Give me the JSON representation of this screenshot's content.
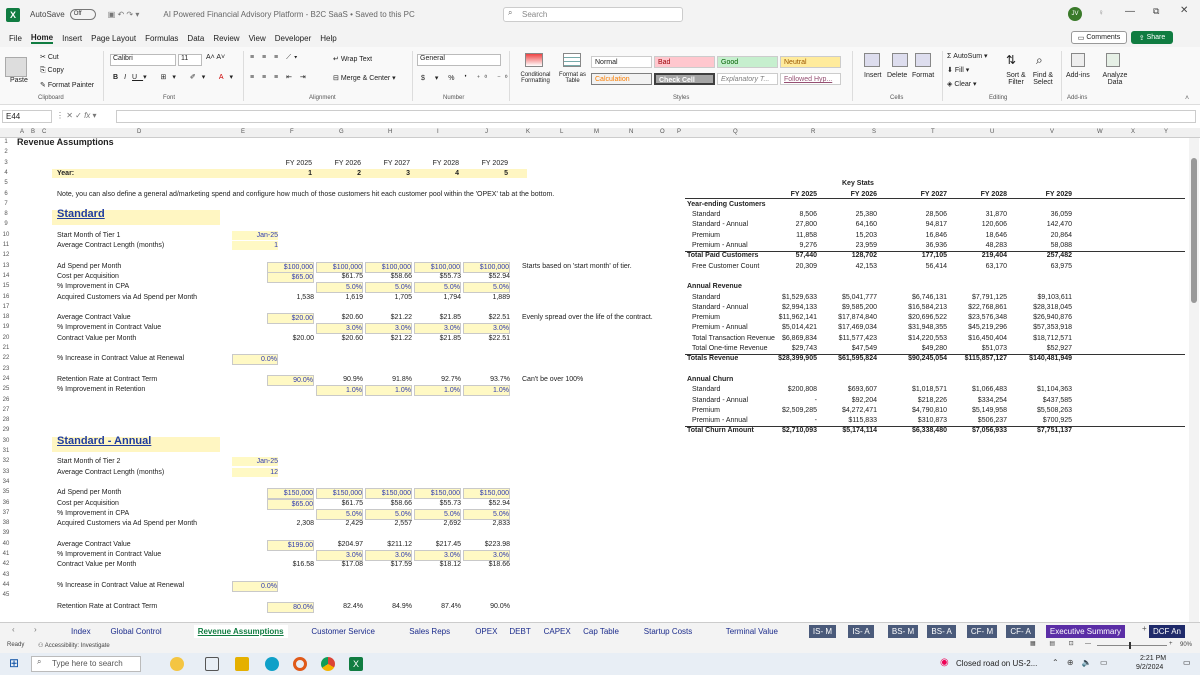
{
  "titlebar": {
    "autosave_label": "AutoSave",
    "autosave_state": "Off",
    "title": "AI Powered Financial Advisory Platform - B2C SaaS • Saved to this PC",
    "search_placeholder": "Search",
    "avatar": "JV"
  },
  "menu": {
    "items": [
      "File",
      "Home",
      "Insert",
      "Page Layout",
      "Formulas",
      "Data",
      "Review",
      "View",
      "Developer",
      "Help"
    ],
    "active": "Home",
    "comments": "Comments",
    "share": "Share"
  },
  "ribbon": {
    "clipboard": {
      "paste": "Paste",
      "cut": "Cut",
      "copy": "Copy",
      "painter": "Format Painter",
      "label": "Clipboard"
    },
    "font": {
      "name": "Calibri",
      "size": "11",
      "label": "Font"
    },
    "alignment": {
      "wrap": "Wrap Text",
      "merge": "Merge & Center",
      "label": "Alignment"
    },
    "number": {
      "format": "General",
      "label": "Number"
    },
    "styles": {
      "cond": "Conditional Formatting",
      "table": "Format as Table",
      "normal": "Normal",
      "bad": "Bad",
      "good": "Good",
      "neutral": "Neutral",
      "calc": "Calculation",
      "check": "Check Cell",
      "expl": "Explanatory T...",
      "followed": "Followed Hyp...",
      "label": "Styles"
    },
    "cells": {
      "insert": "Insert",
      "delete": "Delete",
      "format": "Format",
      "label": "Cells"
    },
    "editing": {
      "autosum": "AutoSum",
      "fill": "Fill",
      "clear": "Clear",
      "sort": "Sort & Filter",
      "find": "Find & Select",
      "label": "Editing"
    },
    "addins": {
      "addins": "Add-ins",
      "analyze": "Analyze Data",
      "label": "Add-ins"
    }
  },
  "formula_bar": {
    "cell": "E44",
    "value": ""
  },
  "columns": [
    "A",
    "B",
    "C",
    "D",
    "E",
    "F",
    "G",
    "H",
    "I",
    "J",
    "K",
    "L",
    "M",
    "N",
    "O",
    "P",
    "Q",
    "R",
    "S",
    "T",
    "U",
    "V",
    "W",
    "X",
    "Y"
  ],
  "rows": [
    "1",
    "2",
    "3",
    "4",
    "5",
    "6",
    "7",
    "8",
    "9",
    "10",
    "11",
    "12",
    "13",
    "14",
    "15",
    "16",
    "17",
    "18",
    "19",
    "20",
    "21",
    "22",
    "23",
    "24",
    "25",
    "26",
    "27",
    "28",
    "29",
    "30",
    "31",
    "32",
    "33",
    "34",
    "35",
    "36",
    "37",
    "38",
    "39",
    "40",
    "41",
    "42",
    "43",
    "44",
    "45"
  ],
  "sheet": {
    "title": "Revenue Assumptions",
    "years": [
      "FY 2025",
      "FY 2026",
      "FY 2027",
      "FY 2028",
      "FY 2029"
    ],
    "year_label": "Year:",
    "year_nums": [
      "1",
      "2",
      "3",
      "4",
      "5"
    ],
    "note": "Note, you can also define a general ad/marketing spend and configure how much of those customers hit each customer pool within the 'OPEX' tab at the bottom.",
    "standard": {
      "header": "Standard",
      "start_label": "Start Month of Tier 1",
      "start_val": "Jan-25",
      "len_label": "Average Contract Length (months)",
      "len_val": "1",
      "ad_label": "Ad Spend per Month",
      "ad": [
        "$100,000",
        "$100,000",
        "$100,000",
        "$100,000",
        "$100,000"
      ],
      "ad_note": "Starts based on 'start month' of tier.",
      "cpa_label": "Cost per Acquisition",
      "cpa": [
        "$65.00",
        "$61.75",
        "$58.66",
        "$55.73",
        "$52.94"
      ],
      "cpa_imp_label": "% Improvement in CPA",
      "cpa_imp": [
        "5.0%",
        "5.0%",
        "5.0%",
        "5.0%"
      ],
      "acq_label": "Acquired Customers via Ad Spend per Month",
      "acq": [
        "1,538",
        "1,619",
        "1,705",
        "1,794",
        "1,889"
      ],
      "acv_label": "Average Contract Value",
      "acv": [
        "$20.00",
        "$20.60",
        "$21.22",
        "$21.85",
        "$22.51"
      ],
      "acv_note": "Evenly spread over the life of the contract.",
      "acv_imp_label": "% Improvement in Contract Value",
      "acv_imp": [
        "3.0%",
        "3.0%",
        "3.0%",
        "3.0%"
      ],
      "cvm_label": "Contract Value per Month",
      "cvm": [
        "$20.00",
        "$20.60",
        "$21.22",
        "$21.85",
        "$22.51"
      ],
      "renew_label": "% Increase in Contract Value at Renewal",
      "renew": "0.0%",
      "ret_label": "Retention Rate at Contract Term",
      "ret": [
        "90.0%",
        "90.9%",
        "91.8%",
        "92.7%",
        "93.7%"
      ],
      "ret_note": "Can't be over 100%",
      "ret_imp_label": "% Improvement in Retention",
      "ret_imp": [
        "1.0%",
        "1.0%",
        "1.0%",
        "1.0%"
      ]
    },
    "annual": {
      "header": "Standard - Annual",
      "start_label": "Start Month of Tier 2",
      "start_val": "Jan-25",
      "len_label": "Average Contract Length (months)",
      "len_val": "12",
      "ad_label": "Ad Spend per Month",
      "ad": [
        "$150,000",
        "$150,000",
        "$150,000",
        "$150,000",
        "$150,000"
      ],
      "cpa_label": "Cost per Acquisition",
      "cpa": [
        "$65.00",
        "$61.75",
        "$58.66",
        "$55.73",
        "$52.94"
      ],
      "cpa_imp_label": "% Improvement in CPA",
      "cpa_imp": [
        "5.0%",
        "5.0%",
        "5.0%",
        "5.0%"
      ],
      "acq_label": "Acquired Customers via Ad Spend per Month",
      "acq": [
        "2,308",
        "2,429",
        "2,557",
        "2,692",
        "2,833"
      ],
      "acv_label": "Average Contract Value",
      "acv": [
        "$199.00",
        "$204.97",
        "$211.12",
        "$217.45",
        "$223.98"
      ],
      "acv_imp_label": "% Improvement in Contract Value",
      "acv_imp": [
        "3.0%",
        "3.0%",
        "3.0%",
        "3.0%"
      ],
      "cvm_label": "Contract Value per Month",
      "cvm": [
        "$16.58",
        "$17.08",
        "$17.59",
        "$18.12",
        "$18.66"
      ],
      "renew_label": "% Increase in Contract Value at Renewal",
      "renew": "0.0%",
      "ret_label": "Retention Rate at Contract Term",
      "ret": [
        "80.0%",
        "82.4%",
        "84.9%",
        "87.4%",
        "90.0%"
      ]
    },
    "keystats": {
      "title": "Key Stats",
      "years": [
        "FY 2025",
        "FY 2026",
        "FY 2027",
        "FY 2028",
        "FY 2029"
      ],
      "customers": {
        "label": "Year-ending Customers",
        "rows": [
          {
            "name": "Standard",
            "v": [
              "8,506",
              "25,380",
              "28,506",
              "31,870",
              "36,059"
            ]
          },
          {
            "name": "Standard - Annual",
            "v": [
              "27,800",
              "64,160",
              "94,817",
              "120,606",
              "142,470"
            ]
          },
          {
            "name": "Premium",
            "v": [
              "11,858",
              "15,203",
              "16,846",
              "18,646",
              "20,864"
            ]
          },
          {
            "name": "Premium - Annual",
            "v": [
              "9,276",
              "23,959",
              "36,936",
              "48,283",
              "58,088"
            ]
          }
        ],
        "total": {
          "name": "Total Paid Customers",
          "v": [
            "57,440",
            "128,702",
            "177,105",
            "219,404",
            "257,482"
          ]
        },
        "free": {
          "name": "Free Customer Count",
          "v": [
            "20,309",
            "42,153",
            "56,414",
            "63,170",
            "63,975"
          ]
        }
      },
      "revenue": {
        "label": "Annual Revenue",
        "rows": [
          {
            "name": "Standard",
            "v": [
              "$1,529,633",
              "$5,041,777",
              "$6,746,131",
              "$7,791,125",
              "$9,103,611"
            ]
          },
          {
            "name": "Standard - Annual",
            "v": [
              "$2,994,133",
              "$9,585,200",
              "$16,584,213",
              "$22,768,861",
              "$28,318,045"
            ]
          },
          {
            "name": "Premium",
            "v": [
              "$11,962,141",
              "$17,874,840",
              "$20,696,522",
              "$23,576,348",
              "$26,940,876"
            ]
          },
          {
            "name": "Premium - Annual",
            "v": [
              "$5,014,421",
              "$17,469,034",
              "$31,948,355",
              "$45,219,296",
              "$57,353,918"
            ]
          },
          {
            "name": "Total Transaction Revenue",
            "v": [
              "$6,869,834",
              "$11,577,423",
              "$14,220,553",
              "$16,450,404",
              "$18,712,571"
            ]
          },
          {
            "name": "Total One-time Revenue",
            "v": [
              "$29,743",
              "$47,549",
              "$49,280",
              "$51,073",
              "$52,927"
            ]
          }
        ],
        "total": {
          "name": "Totals Revenue",
          "v": [
            "$28,399,905",
            "$61,595,824",
            "$90,245,054",
            "$115,857,127",
            "$140,481,949"
          ]
        }
      },
      "churn": {
        "label": "Annual Churn",
        "rows": [
          {
            "name": "Standard",
            "v": [
              "$200,808",
              "$693,607",
              "$1,018,571",
              "$1,066,483",
              "$1,104,363"
            ]
          },
          {
            "name": "Standard - Annual",
            "v": [
              "-",
              "$92,204",
              "$218,226",
              "$334,254",
              "$437,585"
            ]
          },
          {
            "name": "Premium",
            "v": [
              "$2,509,285",
              "$4,272,471",
              "$4,790,810",
              "$5,149,958",
              "$5,508,263"
            ]
          },
          {
            "name": "Premium - Annual",
            "v": [
              "-",
              "$115,833",
              "$310,873",
              "$506,237",
              "$700,925"
            ]
          }
        ],
        "total": {
          "name": "Total Churn Amount",
          "v": [
            "$2,710,093",
            "$5,174,114",
            "$6,338,480",
            "$7,056,933",
            "$7,751,137"
          ]
        }
      }
    }
  },
  "tabs": [
    "Index",
    "Global Control",
    "Revenue Assumptions",
    "Customer Service",
    "Sales Reps",
    "OPEX",
    "DEBT",
    "CAPEX",
    "Cap Table",
    "Startup Costs",
    "Terminal Value",
    "IS- M",
    "IS- A",
    "BS- M",
    "BS- A",
    "CF- M",
    "CF- A",
    "Executive Summary",
    "DCF An"
  ],
  "active_tab": "Revenue Assumptions",
  "status": {
    "ready": "Ready",
    "accessibility": "Accessibility: Investigate",
    "zoom": "90%"
  },
  "taskbar": {
    "search": "Type here to search",
    "weather": "Closed road on US-2...",
    "time": "2:21 PM",
    "date": "9/2/2024"
  }
}
